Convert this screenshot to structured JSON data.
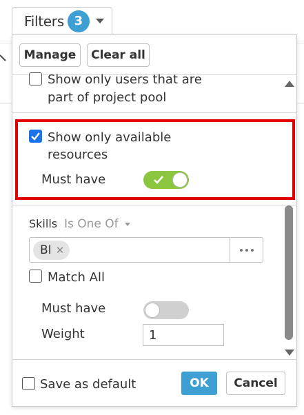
{
  "trigger": {
    "label": "Filters",
    "badge_count": "3"
  },
  "panel": {
    "toolbar": {
      "manage_label": "Manage",
      "clear_all_label": "Clear all"
    },
    "project_pool": {
      "checked": false,
      "label_line1": "Show only users that are",
      "label_line2": "part of project pool"
    },
    "available": {
      "checked": true,
      "label_line1": "Show only available",
      "label_line2": "resources",
      "must_have_label": "Must have",
      "must_have_on": true
    },
    "skills": {
      "label": "Skills",
      "operator": "Is One Of",
      "chips": [
        "BI"
      ],
      "match_all_label": "Match All",
      "match_all_checked": false,
      "must_have_label": "Must have",
      "must_have_on": false,
      "weight_label": "Weight",
      "weight_value": "1"
    },
    "footer": {
      "save_default_label": "Save as default",
      "ok_label": "OK",
      "cancel_label": "Cancel"
    }
  },
  "colors": {
    "accent": "#3e9fd3",
    "checkbox_checked": "#1a73e8",
    "toggle_on": "#8cc63f",
    "toggle_off": "#d0d0d0",
    "highlight": "#e00000"
  },
  "icons": [
    "chevron-down-icon",
    "check-icon",
    "close-icon",
    "ellipsis-icon",
    "scroll-up-icon",
    "scroll-down-icon"
  ]
}
